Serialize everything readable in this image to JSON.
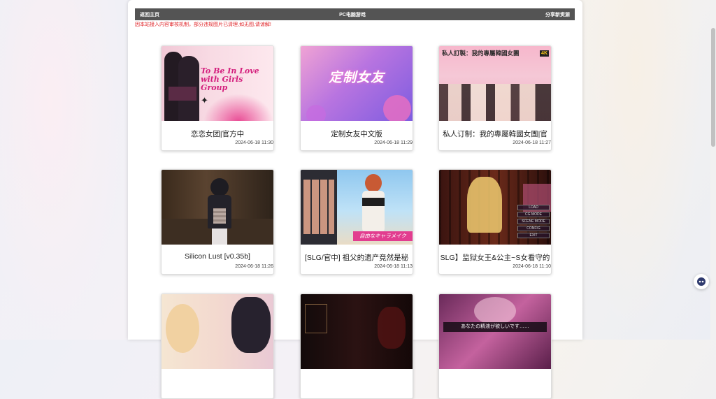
{
  "topbar": {
    "back": "返回主页",
    "title": "PC电脑游戏",
    "share": "分享新资源"
  },
  "notice": "因本站接入内容审核机制，部分违规图片已清理,如无图,请谅解!",
  "cards": [
    {
      "title": "恋恋女团|官方中",
      "date": "2024-06-18 11:30",
      "art_text": "To Be In Love with Girls Group"
    },
    {
      "title": "定制女友中文版",
      "date": "2024-06-18 11:29",
      "art_text": "定制女友"
    },
    {
      "title": "私人订制：我的專屬韓國女團|官",
      "date": "2024-06-18 11:27",
      "art_text": "私人訂製：我的專屬韓國女團",
      "badge": "4K"
    },
    {
      "title": "Silicon Lust [v0.35b]",
      "date": "2024-06-18 11:26"
    },
    {
      "title": "[SLG/官中] 祖父的遗产竟然是秘",
      "date": "2024-06-18 11:13",
      "art_text": "自由なキャラメイク"
    },
    {
      "title": "SLG】监狱女王&公主~S女看守的",
      "date": "2024-06-18 11:10",
      "menu": [
        "LOAD",
        "CG MODE",
        "SCENE MODE",
        "CONFIG",
        "EXIT"
      ]
    },
    {
      "title": "",
      "date": ""
    },
    {
      "title": "",
      "date": ""
    },
    {
      "title": "",
      "date": "",
      "art_text": "あなたの精液が欲しいです……"
    }
  ],
  "colors": {
    "topbar_bg": "#545454",
    "notice": "#e0262a"
  }
}
